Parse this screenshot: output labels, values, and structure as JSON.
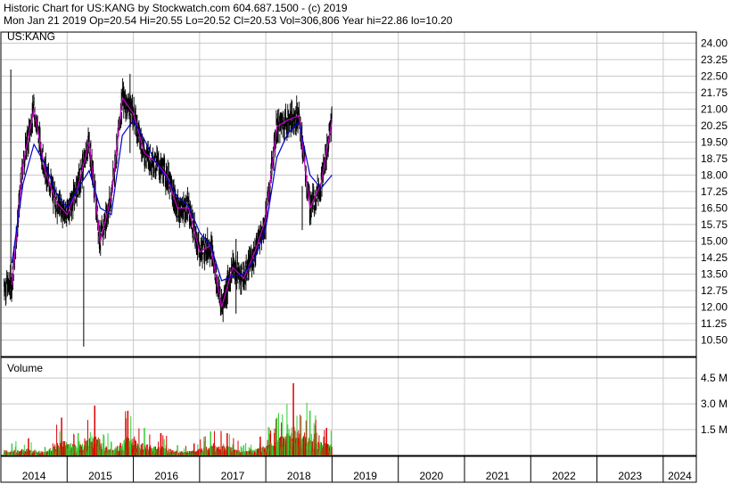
{
  "header": {
    "line1": "Historic Chart for US:KANG by Stockwatch.com 604.687.1500 - (c) 2019",
    "line2": "Mon Jan 21 2019   Op=20.54  Hi=20.55  Lo=20.52  Cl=20.53  Vol=306,806   Year hi=22.86  lo=10.20"
  },
  "colors": {
    "price_bar": "#000000",
    "ma_fast": "#cc00cc",
    "ma_slow": "#0000cc",
    "vol_up": "#33cc33",
    "vol_down": "#dd0000",
    "grid": "#c8c8c8"
  },
  "chart_data": [
    {
      "type": "line",
      "panel": "price",
      "label": "US:KANG",
      "x": [
        "2014-03",
        "2014-05",
        "2014-07",
        "2014-09",
        "2014-11",
        "2015-01",
        "2015-03",
        "2015-05",
        "2015-07",
        "2015-09",
        "2015-11",
        "2016-01",
        "2016-03",
        "2016-05",
        "2016-07",
        "2016-09",
        "2016-11",
        "2017-01",
        "2017-03",
        "2017-05",
        "2017-07",
        "2017-09",
        "2017-11",
        "2018-01",
        "2018-03",
        "2018-05",
        "2018-07",
        "2018-09",
        "2018-11",
        "2019-01"
      ],
      "series": [
        {
          "values": [
            13.0,
            18.5,
            21.0,
            18.2,
            16.8,
            16.2,
            17.5,
            19.5,
            15.0,
            17.0,
            21.5,
            20.8,
            19.0,
            18.6,
            18.0,
            16.5,
            16.5,
            14.5,
            14.8,
            12.0,
            13.8,
            13.3,
            14.5,
            16.0,
            20.2,
            20.5,
            20.7,
            16.5,
            17.6,
            20.5
          ]
        },
        {
          "values": [
            14.0,
            17.6,
            19.4,
            18.5,
            17.2,
            16.5,
            17.4,
            18.2,
            16.5,
            16.2,
            19.8,
            20.5,
            19.6,
            18.6,
            17.9,
            17.0,
            16.6,
            15.4,
            14.8,
            13.2,
            13.4,
            13.5,
            14.2,
            15.6,
            18.8,
            19.9,
            20.4,
            18.0,
            17.4,
            18.0
          ]
        }
      ],
      "y_ticks": [
        "24.00",
        "23.25",
        "22.50",
        "21.75",
        "21.00",
        "20.25",
        "19.50",
        "18.75",
        "18.00",
        "17.25",
        "16.50",
        "15.75",
        "15.00",
        "14.25",
        "13.50",
        "12.75",
        "12.00",
        "11.25",
        "10.50"
      ],
      "ylim": [
        9.75,
        24.5
      ]
    },
    {
      "type": "bar",
      "panel": "volume",
      "title": "Volume",
      "x": [
        "2014-03",
        "2014-06",
        "2014-09",
        "2014-12",
        "2015-03",
        "2015-06",
        "2015-09",
        "2015-12",
        "2016-03",
        "2016-06",
        "2016-09",
        "2016-12",
        "2017-03",
        "2017-06",
        "2017-09",
        "2017-12",
        "2018-03",
        "2018-06",
        "2018-09",
        "2018-12"
      ],
      "values": [
        0.7,
        1.0,
        0.5,
        2.2,
        1.3,
        2.9,
        0.8,
        2.6,
        1.6,
        1.3,
        0.6,
        0.7,
        1.4,
        1.3,
        0.6,
        1.1,
        2.2,
        4.2,
        2.6,
        1.6
      ],
      "y_ticks": [
        "4.5 M",
        "3.0 M",
        "1.5 M"
      ],
      "ylim": [
        0,
        5.7
      ]
    }
  ],
  "x_axis": {
    "labels": [
      "2014",
      "2015",
      "2016",
      "2017",
      "2018",
      "2019",
      "2020",
      "2021",
      "2022",
      "2023",
      "2024"
    ]
  }
}
